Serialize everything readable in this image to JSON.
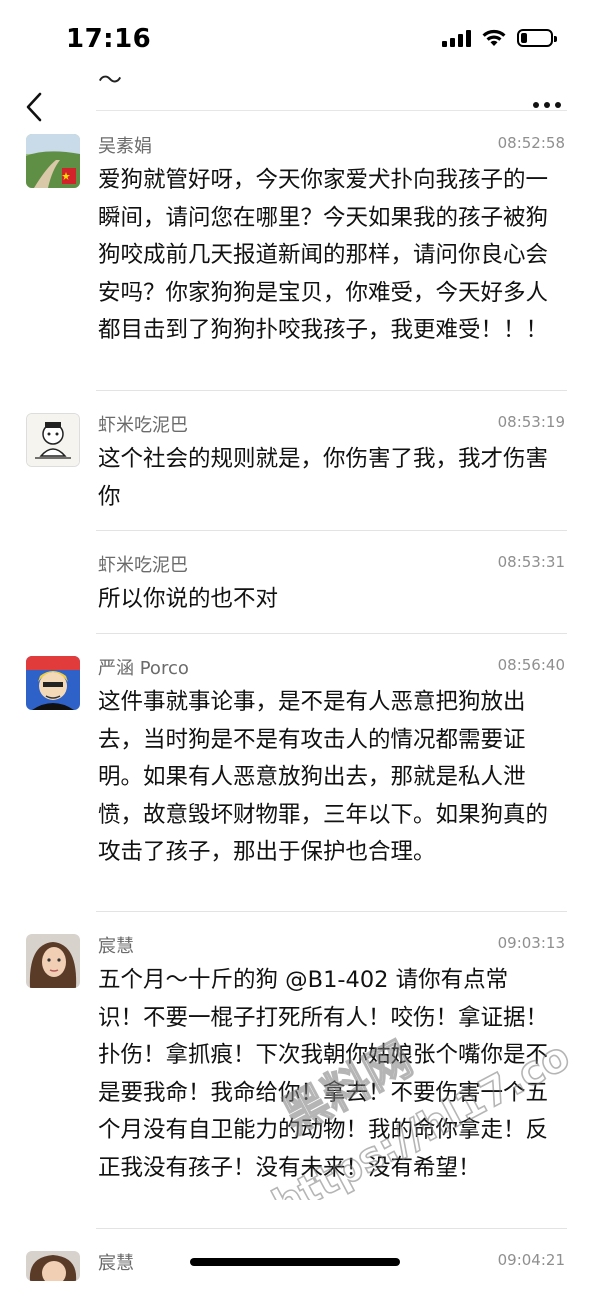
{
  "status": {
    "time": "17:16"
  },
  "nav": {
    "title": "～"
  },
  "comments": [
    {
      "author": "吴素娟",
      "time": "08:52:58",
      "text": "爱狗就管好呀，今天你家爱犬扑向我孩子的一瞬间，请问您在哪里？今天如果我的孩子被狗狗咬成前几天报道新闻的那样，请问你良心会安吗？你家狗狗是宝贝，你难受，今天好多人都目击到了狗狗扑咬我孩子，我更难受！！！"
    },
    {
      "author": "虾米吃泥巴",
      "time": "08:53:19",
      "text": "这个社会的规则就是，你伤害了我，我才伤害你"
    },
    {
      "author": "虾米吃泥巴",
      "time": "08:53:31",
      "text": "所以你说的也不对"
    },
    {
      "author": "严涵 Porco",
      "time": "08:56:40",
      "text": "这件事就事论事，是不是有人恶意把狗放出去，当时狗是不是有攻击人的情况都需要证明。如果有人恶意放狗出去，那就是私人泄愤，故意毁坏财物罪，三年以下。如果狗真的攻击了孩子，那出于保护也合理。"
    },
    {
      "author": "宸慧",
      "time": "09:03:13",
      "text": "五个月～十斤的狗 @B1-402 请你有点常识！不要一棍子打死所有人！咬伤！拿证据！扑伤！拿抓痕！下次我朝你姑娘张个嘴你是不是要我命！我命给你！拿去！不要伤害一个五个月没有自卫能力的动物！我的命你拿走！反正我没有孩子！没有未来！没有希望！"
    },
    {
      "author": "宸慧",
      "time": "09:04:21",
      "text": ""
    }
  ],
  "watermark": {
    "line1": "黑料网",
    "line2": "https://hl17.co"
  }
}
